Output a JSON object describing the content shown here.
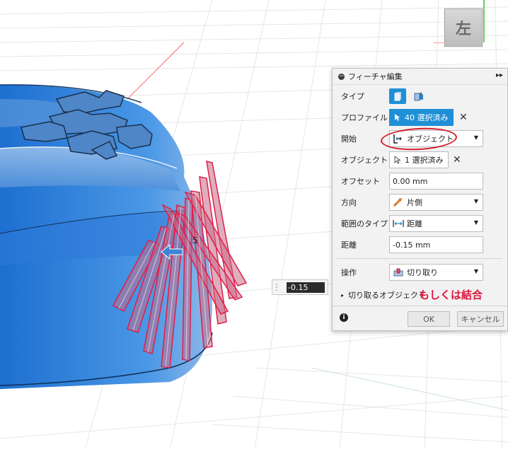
{
  "viewcube": {
    "face_label": "左"
  },
  "dimension_input": {
    "value": "-0.15 mm"
  },
  "panel": {
    "title": "フィーチャ編集",
    "rows": {
      "type": {
        "label": "タイプ"
      },
      "profile": {
        "label": "プロファイル",
        "button": "40 選択済み"
      },
      "start": {
        "label": "開始",
        "value": "オブジェクト"
      },
      "object": {
        "label": "オブジェクト",
        "button": "1 選択済み"
      },
      "offset": {
        "label": "オフセット",
        "value": "0.00 mm"
      },
      "direction": {
        "label": "方向",
        "value": "片側"
      },
      "extent_type": {
        "label": "範囲のタイプ",
        "value": "距離"
      },
      "distance": {
        "label": "距離",
        "value": "-0.15 mm"
      },
      "operation": {
        "label": "操作",
        "value": "切り取り"
      }
    },
    "objects_to_cut": "切り取るオブジェクト",
    "ok_label": "OK",
    "cancel_label": "キャンセル"
  },
  "annotation": {
    "text": "もしくは結合"
  },
  "viewport": {
    "dimension_marker": "5"
  },
  "colors": {
    "accent": "#1f8fd6",
    "annotation": "#e0143c",
    "body": "#3b86d6",
    "cut": "#e8506a"
  }
}
